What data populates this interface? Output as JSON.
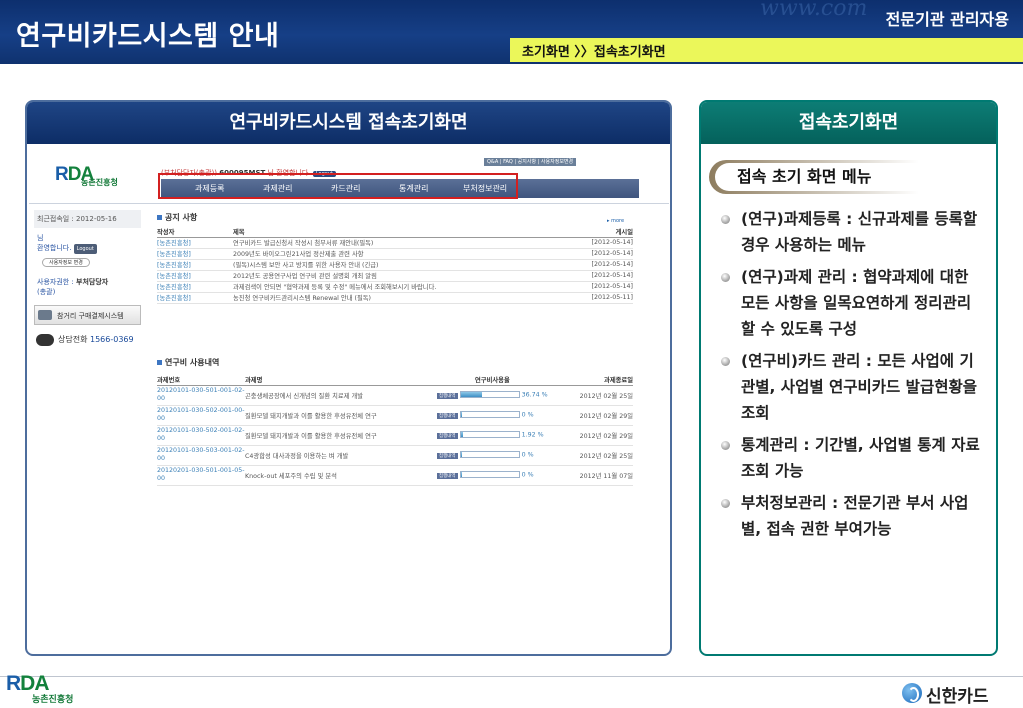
{
  "header": {
    "title": "연구비카드시스템 안내",
    "subtitle": "전문기관 관리자용",
    "watermark": "www.com",
    "breadcrumb": "초기화면 〉〉접속초기화면"
  },
  "left_panel": {
    "title": "연구비카드시스템 접속초기화면",
    "app": {
      "logo": {
        "mark_r": "R",
        "mark_d": "D",
        "mark_a": "A",
        "text": "농촌진흥청"
      },
      "user_line": {
        "name_prefix": "(부처담당자(총괄))",
        "user_id": "600095MST",
        "suffix": "님 환영합니다.",
        "logout": "Logout"
      },
      "top_links": "Q&A | FAQ | 공지사항 | 사용자정보변경",
      "nav": [
        "과제등록",
        "과제관리",
        "카드관리",
        "통계관리",
        "부처정보관리"
      ],
      "sidebar": {
        "last_login": "최근접속일 : 2012-05-16",
        "welcome_1": "님",
        "welcome_2": "환영합니다.",
        "logout": "Logout",
        "userinfo_btn": "사용자정보 변경",
        "role_label": "사용자권한 :",
        "role_value": "부처담당자",
        "role_scope": "(총괄)",
        "buy_banner": "참거리 구매결제시스템",
        "call_label": "상담전화",
        "call_number": "1566-0369"
      },
      "notice": {
        "title": "공지 사항",
        "more": "▸ more",
        "headers": [
          "작성자",
          "제목",
          "게시일"
        ],
        "rows": [
          [
            "[농촌진흥청]",
            "연구비카드 발급신청서 작성시 첨부서류 재안내(필독)",
            "[2012-05-14]"
          ],
          [
            "[농촌진흥청]",
            "2009년도 바이오그린21사업 정산제출 관련 사항",
            "[2012-05-14]"
          ],
          [
            "[농촌진흥청]",
            "(필독)시스템 보안 사고 방지를 위한 사용자 안내 (긴급)",
            "[2012-05-14]"
          ],
          [
            "[농촌진흥청]",
            "2012년도 공용연구사업 연구비 관련 설명회 개최 알림",
            "[2012-05-14]"
          ],
          [
            "[농촌진흥청]",
            "과제검색이 안되면 \"협약과제 등록 및 수정\" 메뉴에서 조회해보시기 바랍니다.",
            "[2012-05-14]"
          ],
          [
            "[농촌진흥청]",
            "농진청 연구비카드관리시스템 Renewal 안내 (필독)",
            "[2012-05-11]"
          ]
        ]
      },
      "usage": {
        "title": "연구비 사용내역",
        "headers": [
          "과제번호",
          "과제명",
          "연구비사용율",
          "과제종료일"
        ],
        "detail_label": "집행내역",
        "rows": [
          {
            "no": "20120101-030-501-001-02-00",
            "name": "곤충생체공장에서 신개념의 질환 치료제 개발",
            "pct_text": "36.74 %",
            "pct": 0.3674,
            "end": "2012년 02월 25일"
          },
          {
            "no": "20120101-030-502-001-00-00",
            "name": "질환모델 돼지개발과 이를 활용한 후성유전체 연구",
            "pct_text": "0 %",
            "pct": 0,
            "end": "2012년 02월 29일"
          },
          {
            "no": "20120101-030-502-001-02-00",
            "name": "질환모델 돼지개발과 이를 활용한 후성유전체 연구",
            "pct_text": "1.92 %",
            "pct": 0.0192,
            "end": "2012년 02월 29일"
          },
          {
            "no": "20120101-030-503-001-02-00",
            "name": "C4광합성 대사과정을 이용하는 벼 개발",
            "pct_text": "0 %",
            "pct": 0,
            "end": "2012년 02월 25일"
          },
          {
            "no": "20120201-030-501-001-05-00",
            "name": "Knock-out 세포주의 수립 및 분석",
            "pct_text": "0 %",
            "pct": 0,
            "end": "2012년 11월 07일"
          }
        ]
      }
    }
  },
  "right_panel": {
    "title": "접속초기화면",
    "tab": "접속 초기 화면 메뉴",
    "items": [
      "(연구)과제등록 : 신규과제를 등록할 경우 사용하는 메뉴",
      "(연구)과제 관리 : 협약과제에 대한 모든 사항을 일목요연하게 정리관리 할 수 있도록 구성",
      "(연구비)카드 관리 : 모든 사업에 기관별, 사업별 연구비카드 발급현황을 조회",
      "통계관리 : 기간별, 사업별 통계 자료 조회 가능",
      "부처정보관리 : 전문기관 부서 사업별, 접속 권한 부여가능"
    ]
  },
  "footer": {
    "rda_r": "R",
    "rda_d": "D",
    "rda_a": "A",
    "rda_text": "농촌진흥청",
    "shinhan": "신한카드"
  }
}
